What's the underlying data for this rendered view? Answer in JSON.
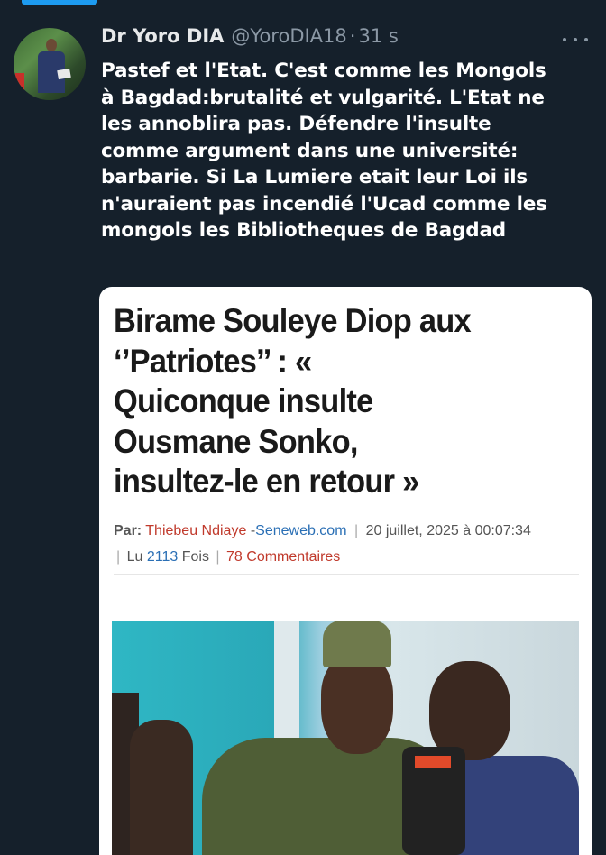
{
  "tweet": {
    "author_name": "Dr Yoro DIA",
    "author_handle": "@YoroDIA18",
    "separator": "·",
    "timestamp": "31 s",
    "text_lines": [
      "Pastef et l'Etat. C'est comme les Mongols",
      "à Bagdad:brutalité et vulgarité. L'Etat ne",
      "les annoblira pas. Défendre l'insulte",
      "comme argument dans une université:",
      "barbarie. Si La Lumiere etait leur Loi  ils",
      "n'auraient pas incendié l'Ucad comme les",
      "mongols les Bibliotheques de Bagdad"
    ]
  },
  "article": {
    "headline_lines": [
      "Birame Souleye Diop aux",
      "‘’Patriotes’’ : «",
      "Quiconque insulte",
      "Ousmane Sonko,",
      "insultez-le en retour »"
    ],
    "by_label": "Par:",
    "author": "Thiebeu Ndiaye",
    "dash": "-",
    "site": "Seneweb.com",
    "date": "20 juillet, 2025 à 00:07:34",
    "read_label": "Lu",
    "read_count": "2113",
    "read_suffix": "Fois",
    "comments": "78 Commentaires"
  },
  "colors": {
    "background": "#15202b",
    "accent": "#1d9bf0",
    "muted": "#8b98a5",
    "author_red": "#c0392b",
    "link_blue": "#2a6fb5"
  },
  "icons": {
    "more": "more-horizontal-icon"
  }
}
